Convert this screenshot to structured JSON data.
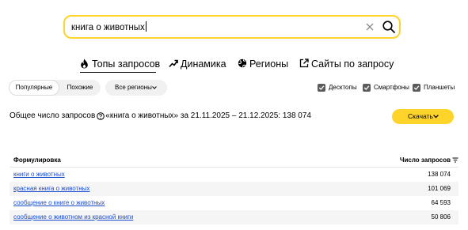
{
  "search": {
    "value": "книга о животных"
  },
  "tabs": [
    {
      "label": "Топы запросов",
      "icon": "fire-icon",
      "active": true
    },
    {
      "label": "Динамика",
      "icon": "trend-icon",
      "active": false
    },
    {
      "label": "Регионы",
      "icon": "globe-icon",
      "active": false
    },
    {
      "label": "Сайты по запросу",
      "icon": "external-link-icon",
      "active": false
    }
  ],
  "filters": {
    "segments": [
      {
        "label": "Популярные",
        "selected": true
      },
      {
        "label": "Похожие",
        "selected": false
      }
    ],
    "region_label": "Все регионы",
    "devices": [
      {
        "label": "Десктопы",
        "checked": true
      },
      {
        "label": "Смартфоны",
        "checked": true
      },
      {
        "label": "Планшеты",
        "checked": true
      }
    ]
  },
  "summary": {
    "prefix": "Общее число запросов",
    "rest": " «книга о животных» за 21.11.2025 – 21.12.2025: 138 074"
  },
  "download_label": "Скачать",
  "table": {
    "col_query": "Формулировка",
    "col_count": "Число запросов",
    "rows": [
      {
        "query": "книги о животных",
        "count": "138 074"
      },
      {
        "query": "красная книга о животных",
        "count": "101 069"
      },
      {
        "query": "сообщение о книге о животных",
        "count": "64 593"
      },
      {
        "query": "сообщение о животном из красной книги",
        "count": "50 806"
      }
    ]
  },
  "colors": {
    "accent": "#fed42b",
    "link": "#1a4ccf",
    "row_alt": "#f5f5f5",
    "checkbox": "#5c5c5c"
  }
}
